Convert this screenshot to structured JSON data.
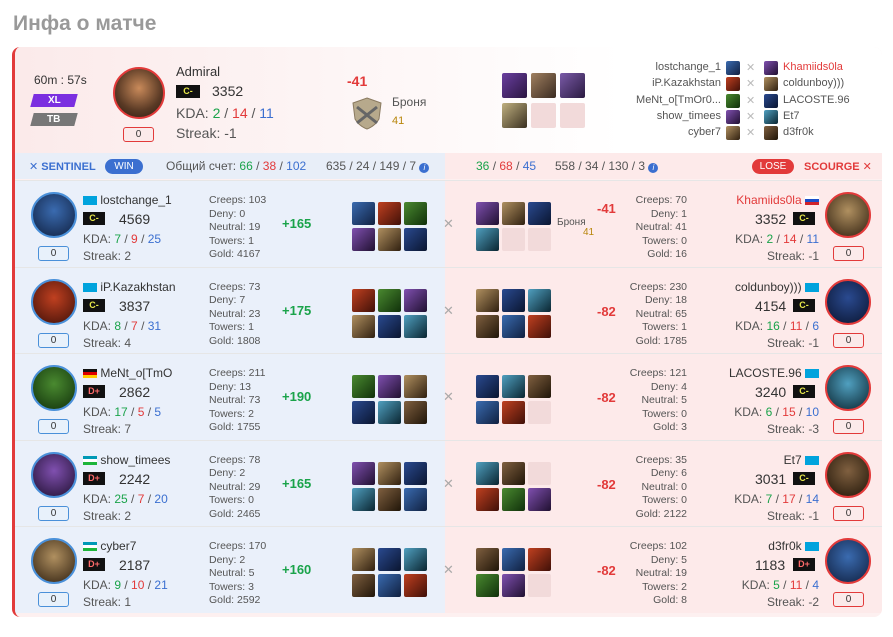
{
  "page_title": "Инфа о матче",
  "match": {
    "duration": "60m : 57s",
    "tag1": "XL",
    "tag2": "TB",
    "player": "Admiral",
    "rank": "C-",
    "rating": "3352",
    "kda_label": "KDA:",
    "k": "2",
    "d": "14",
    "a": "11",
    "streak": "Streak: -1",
    "zero": "0",
    "diff": "-41",
    "armor_label": "Броня",
    "armor": "41"
  },
  "roster": [
    {
      "left": "lostchange_1",
      "right": "Khamiids0la",
      "right_red": true
    },
    {
      "left": "iP.Kazakhstan",
      "right": "coldunboy)))",
      "right_red": false
    },
    {
      "left": "MeNt_o[TmOr0...",
      "right": "LACOSTE.96",
      "right_red": false
    },
    {
      "left": "show_timees",
      "right": "Et7",
      "right_red": false
    },
    {
      "left": "cyber7",
      "right": "d3fr0k",
      "right_red": false
    }
  ],
  "bar": {
    "sentinel": "SENTINEL",
    "win": "WIN",
    "total_label": "Общий счет:",
    "s_k": "66",
    "s_d": "38",
    "s_a": "102",
    "s_misc": "635 / 24 / 149 / 7",
    "r_k": "36",
    "r_d": "68",
    "r_a": "45",
    "r_misc": "558 / 34 / 130 / 3",
    "lose": "LOSE",
    "scourge": "SCOURGE"
  },
  "rows": [
    {
      "ln": "lostchange_1",
      "lr": "C-",
      "lrt": "4569",
      "lk": "7",
      "ld": "9",
      "la": "25",
      "ls": "Streak: 2",
      "lst": [
        "Creeps: 103",
        "Deny: 0",
        "Neutral: 19",
        "Towers: 1",
        "Gold: 4167"
      ],
      "lg": "+165",
      "rn": "Khamiids0la",
      "rr": "C-",
      "rrt": "3352",
      "rk": "2",
      "rd": "14",
      "ra": "11",
      "rs": "Streak: -1",
      "rst": [
        "Creeps: 70",
        "Deny: 1",
        "Neutral: 41",
        "Towers: 0",
        "Gold: 16"
      ],
      "rg": "-41",
      "armor": true,
      "armor_label": "Броня",
      "armor_val": "41",
      "zero": "0"
    },
    {
      "ln": "iP.Kazakhstan",
      "lr": "C-",
      "lrt": "3837",
      "lk": "8",
      "ld": "7",
      "la": "31",
      "ls": "Streak: 4",
      "lst": [
        "Creeps: 73",
        "Deny: 7",
        "Neutral: 23",
        "Towers: 1",
        "Gold: 1808"
      ],
      "lg": "+175",
      "rn": "coldunboy)))",
      "rr": "C-",
      "rrt": "4154",
      "rk": "16",
      "rd": "11",
      "ra": "6",
      "rs": "Streak: -1",
      "rst": [
        "Creeps: 230",
        "Deny: 18",
        "Neutral: 65",
        "Towers: 1",
        "Gold: 1785"
      ],
      "rg": "-82",
      "zero": "0"
    },
    {
      "ln": "MeNt_o[TmO",
      "lr": "D+",
      "lrt": "2862",
      "lk": "17",
      "ld": "5",
      "la": "5",
      "ls": "Streak: 7",
      "lst": [
        "Creeps: 211",
        "Deny: 13",
        "Neutral: 73",
        "Towers: 2",
        "Gold: 1755"
      ],
      "lg": "+190",
      "rn": "LACOSTE.96",
      "rr": "C-",
      "rrt": "3240",
      "rk": "6",
      "rd": "15",
      "ra": "10",
      "rs": "Streak: -3",
      "rst": [
        "Creeps: 121",
        "Deny: 4",
        "Neutral: 5",
        "Towers: 0",
        "Gold: 3"
      ],
      "rg": "-82",
      "zero": "0"
    },
    {
      "ln": "show_timees",
      "lr": "D+",
      "lrt": "2242",
      "lk": "25",
      "ld": "7",
      "la": "20",
      "ls": "Streak: 2",
      "lst": [
        "Creeps: 78",
        "Deny: 2",
        "Neutral: 29",
        "Towers: 0",
        "Gold: 2465"
      ],
      "lg": "+165",
      "rn": "Et7",
      "rr": "C-",
      "rrt": "3031",
      "rk": "7",
      "rd": "17",
      "ra": "14",
      "rs": "Streak: -1",
      "rst": [
        "Creeps: 35",
        "Deny: 6",
        "Neutral: 0",
        "Towers: 0",
        "Gold: 2122"
      ],
      "rg": "-82",
      "zero": "0"
    },
    {
      "ln": "cyber7",
      "lr": "D+",
      "lrt": "2187",
      "lk": "9",
      "ld": "10",
      "la": "21",
      "ls": "Streak: 1",
      "lst": [
        "Creeps: 170",
        "Deny: 2",
        "Neutral: 5",
        "Towers: 3",
        "Gold: 2592"
      ],
      "lg": "+160",
      "rn": "d3fr0k",
      "rr": "D+",
      "rrt": "1183",
      "rk": "5",
      "rd": "11",
      "ra": "4",
      "rs": "Streak: -2",
      "rst": [
        "Creeps: 102",
        "Deny: 5",
        "Neutral: 19",
        "Towers: 2",
        "Gold: 8"
      ],
      "rg": "-82",
      "zero": "0"
    }
  ],
  "colors": {
    "sentinel": "#3b6fd0",
    "scourge": "#e23a3a",
    "win": "#1aa34a"
  }
}
